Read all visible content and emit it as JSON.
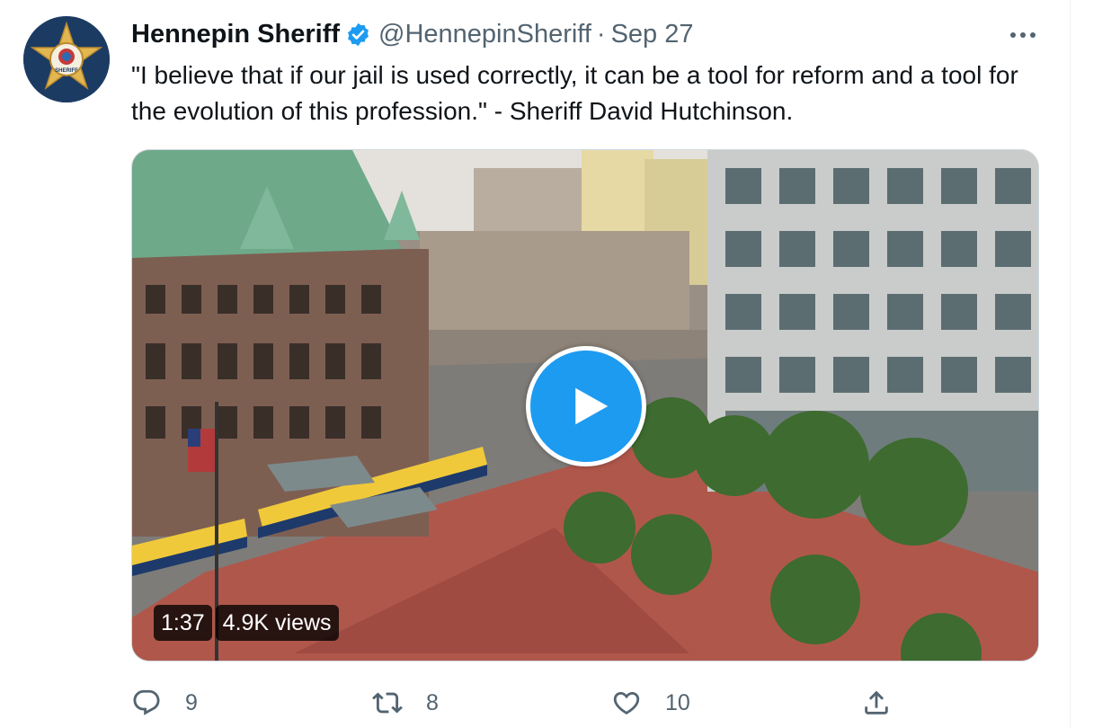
{
  "tweet": {
    "display_name": "Hennepin Sheriff",
    "handle": "@HennepinSheriff",
    "separator": "·",
    "date": "Sep 27",
    "avatar_text": "SHERIFF",
    "text": "\"I believe that if our jail is used correctly, it can be a tool for reform and a tool for the evolution of this profession.\" - Sheriff David Hutchinson."
  },
  "video": {
    "duration": "1:37",
    "views": "4.9K views"
  },
  "actions": {
    "reply_count": "9",
    "retweet_count": "8",
    "like_count": "10"
  },
  "colors": {
    "accent": "#1d9bf0",
    "secondary_text": "#536471",
    "primary_text": "#0f1419",
    "avatar_bg": "#1c3b63",
    "badge_gold": "#e2b650"
  },
  "icons": [
    "verified-badge-icon",
    "more-icon",
    "play-icon",
    "reply-icon",
    "retweet-icon",
    "like-icon",
    "share-icon"
  ]
}
